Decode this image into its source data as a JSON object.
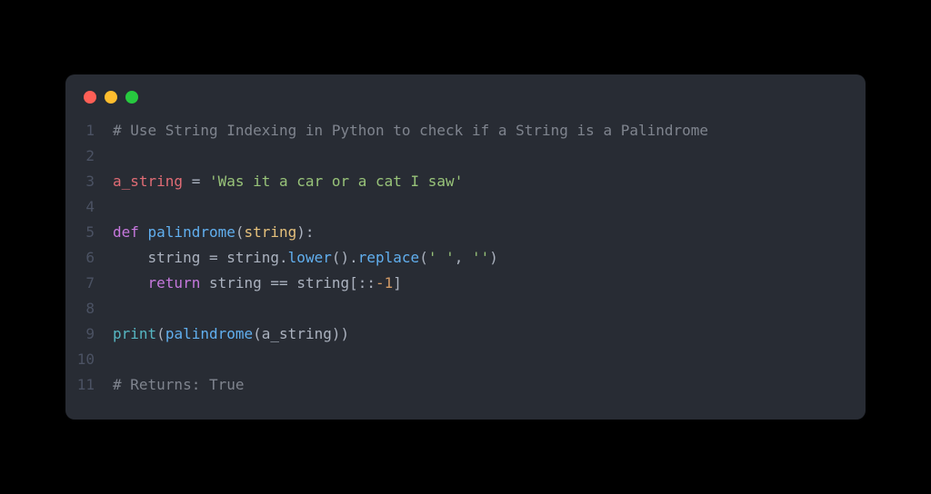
{
  "lines": [
    {
      "n": "1",
      "tokens": [
        {
          "cls": "tok-comment",
          "t": "# Use String Indexing in Python to check if a String is a Palindrome"
        }
      ]
    },
    {
      "n": "2",
      "tokens": []
    },
    {
      "n": "3",
      "tokens": [
        {
          "cls": "tok-var",
          "t": "a_string"
        },
        {
          "cls": "tok-op",
          "t": " = "
        },
        {
          "cls": "tok-string",
          "t": "'Was it a car or a cat I saw'"
        }
      ]
    },
    {
      "n": "4",
      "tokens": []
    },
    {
      "n": "5",
      "tokens": [
        {
          "cls": "tok-keyword",
          "t": "def "
        },
        {
          "cls": "tok-func",
          "t": "palindrome"
        },
        {
          "cls": "tok-punct",
          "t": "("
        },
        {
          "cls": "tok-param",
          "t": "string"
        },
        {
          "cls": "tok-punct",
          "t": "):"
        }
      ]
    },
    {
      "n": "6",
      "tokens": [
        {
          "cls": "tok-prop",
          "t": "    string "
        },
        {
          "cls": "tok-op",
          "t": "= "
        },
        {
          "cls": "tok-prop",
          "t": "string"
        },
        {
          "cls": "tok-punct",
          "t": "."
        },
        {
          "cls": "tok-func",
          "t": "lower"
        },
        {
          "cls": "tok-punct",
          "t": "()."
        },
        {
          "cls": "tok-func",
          "t": "replace"
        },
        {
          "cls": "tok-punct",
          "t": "("
        },
        {
          "cls": "tok-string",
          "t": "' '"
        },
        {
          "cls": "tok-punct",
          "t": ", "
        },
        {
          "cls": "tok-string",
          "t": "''"
        },
        {
          "cls": "tok-punct",
          "t": ")"
        }
      ]
    },
    {
      "n": "7",
      "tokens": [
        {
          "cls": "tok-keyword",
          "t": "    return "
        },
        {
          "cls": "tok-prop",
          "t": "string "
        },
        {
          "cls": "tok-op",
          "t": "== "
        },
        {
          "cls": "tok-prop",
          "t": "string"
        },
        {
          "cls": "tok-punct",
          "t": "[::"
        },
        {
          "cls": "tok-num",
          "t": "-1"
        },
        {
          "cls": "tok-punct",
          "t": "]"
        }
      ]
    },
    {
      "n": "8",
      "tokens": []
    },
    {
      "n": "9",
      "tokens": [
        {
          "cls": "tok-builtin",
          "t": "print"
        },
        {
          "cls": "tok-punct",
          "t": "("
        },
        {
          "cls": "tok-func",
          "t": "palindrome"
        },
        {
          "cls": "tok-punct",
          "t": "("
        },
        {
          "cls": "tok-prop",
          "t": "a_string"
        },
        {
          "cls": "tok-punct",
          "t": "))"
        }
      ]
    },
    {
      "n": "10",
      "tokens": []
    },
    {
      "n": "11",
      "tokens": [
        {
          "cls": "tok-comment",
          "t": "# Returns: True"
        }
      ]
    }
  ]
}
